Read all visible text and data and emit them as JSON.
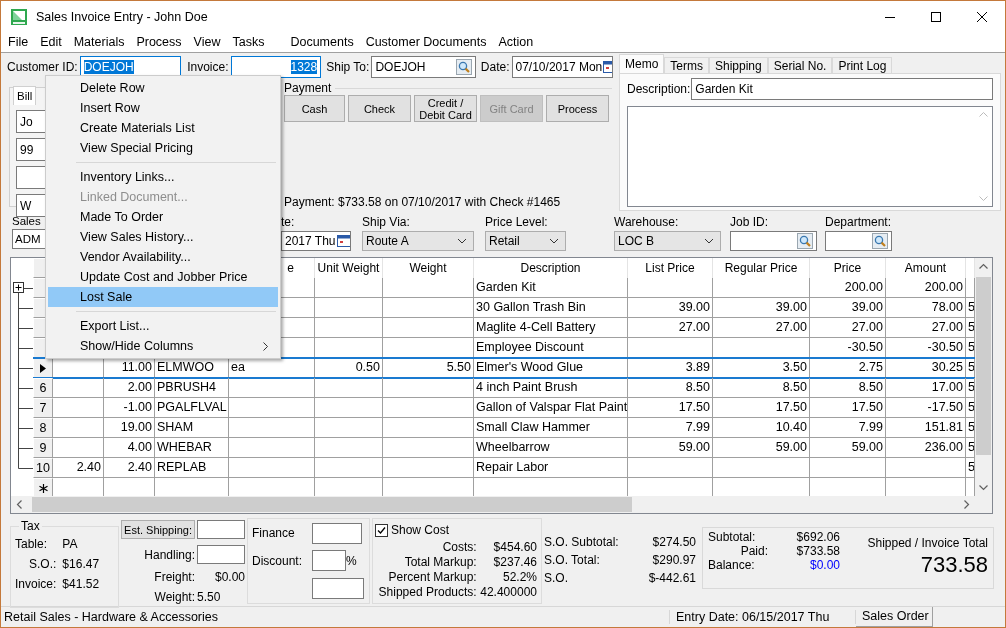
{
  "window": {
    "title": "Sales Invoice Entry - John Doe"
  },
  "menu_bar": [
    "File",
    "Edit",
    "Materials",
    "Process",
    "View",
    "Tasks",
    "Documents",
    "Customer Documents",
    "Action"
  ],
  "header_fields": [
    {
      "label": "Customer ID:",
      "value": "DOEJOH",
      "kind": "text",
      "selected": true
    },
    {
      "label": "Invoice:",
      "value": "1328",
      "kind": "number",
      "selected": true
    },
    {
      "label": "Ship To:",
      "value": "DOEJOH",
      "kind": "lookup",
      "selected": false
    },
    {
      "label": "Date:",
      "value": "07/10/2017 Mon",
      "kind": "date",
      "selected": false
    }
  ],
  "bill_to": {
    "tab": "Bill",
    "lines": [
      {
        "kind": "text",
        "value": "Jo"
      },
      {
        "kind": "text",
        "value": "99"
      },
      {
        "kind": "empty"
      },
      {
        "kind": "text",
        "value": "W"
      }
    ]
  },
  "payment": {
    "title": "Payment",
    "buttons": [
      {
        "label": "Cash",
        "disabled": false
      },
      {
        "label": "Check",
        "disabled": false
      },
      {
        "label": "Credit / Debit Card",
        "disabled": false
      },
      {
        "label": "Gift Card",
        "disabled": true
      },
      {
        "label": "Process",
        "disabled": false
      }
    ],
    "note": "Payment: $733.58 on 07/10/2017 with Check #1465"
  },
  "memo": {
    "tabs": [
      {
        "label": "Memo",
        "selected": true
      },
      {
        "label": "Terms",
        "selected": false
      },
      {
        "label": "Shipping",
        "selected": false
      },
      {
        "label": "Serial No.",
        "selected": false
      },
      {
        "label": "Print Log",
        "selected": false
      }
    ],
    "description_label": "Description:",
    "description": "Garden Kit"
  },
  "order_fields": [
    {
      "label": "Sales",
      "value": "ADM",
      "kind": "text"
    },
    {
      "label": "te:",
      "value": "2017 Thu",
      "kind": "date"
    },
    {
      "label": "Ship Via:",
      "value": "Route A",
      "kind": "select"
    },
    {
      "label": "Price Level:",
      "value": "Retail",
      "kind": "select"
    },
    {
      "label": "Warehouse:",
      "value": "LOC B",
      "kind": "select"
    },
    {
      "label": "Job ID:",
      "kind": "lookup"
    },
    {
      "label": "Department:",
      "kind": "lookup"
    }
  ],
  "table": {
    "columns": {
      "column_4": "e",
      "unit_weight": "Unit Weight",
      "weight": "Weight",
      "description": "Description",
      "list_price": "List Price",
      "regular_price": "Regular Price",
      "price": "Price",
      "amount": "Amount"
    },
    "rows": [
      {
        "kind": "group",
        "selected": false,
        "cells": {
          "description": "Garden Kit",
          "price": "200.00",
          "amount": "200.00"
        }
      },
      {
        "kind": "item",
        "selected": false,
        "cells": {
          "description": "30 Gallon Trash Bin",
          "list_price": "39.00",
          "regular_price": "39.00",
          "price": "39.00",
          "amount": "78.00",
          "column_12": "5"
        }
      },
      {
        "kind": "item",
        "selected": false,
        "cells": {
          "description": "Maglite 4-Cell Battery",
          "list_price": "27.00",
          "regular_price": "27.00",
          "price": "27.00",
          "amount": "27.00",
          "column_12": "5"
        }
      },
      {
        "kind": "item",
        "selected": false,
        "cells": {
          "description": "Employee Discount",
          "price": "-30.50",
          "amount": "-30.50",
          "column_12": "5"
        }
      },
      {
        "kind": "item",
        "selected": true,
        "cells": {
          "column_2": "11.00",
          "column_3": "ELMWOO",
          "column_4": "ea",
          "unit_weight": "0.50",
          "weight": "5.50",
          "description": "Elmer's Wood Glue",
          "list_price": "3.89",
          "regular_price": "3.50",
          "price": "2.75",
          "amount": "30.25",
          "column_12": "5"
        }
      },
      {
        "kind": "item",
        "selected": false,
        "number": "6",
        "cells": {
          "column_2": "2.00",
          "column_3": "PBRUSH4",
          "description": "4 inch Paint Brush",
          "list_price": "8.50",
          "regular_price": "8.50",
          "price": "8.50",
          "amount": "17.00",
          "column_12": "5"
        }
      },
      {
        "kind": "item",
        "selected": false,
        "number": "7",
        "cells": {
          "column_2": "-1.00",
          "column_3": "PGALFLVAL",
          "description": "Gallon of Valspar Flat Paint",
          "list_price": "17.50",
          "regular_price": "17.50",
          "price": "17.50",
          "amount": "-17.50",
          "column_12": "5"
        }
      },
      {
        "kind": "item",
        "selected": false,
        "number": "8",
        "cells": {
          "column_2": "19.00",
          "column_3": "SHAM",
          "description": "Small Claw Hammer",
          "list_price": "7.99",
          "regular_price": "10.40",
          "price": "7.99",
          "amount": "151.81",
          "column_12": "5"
        }
      },
      {
        "kind": "item",
        "selected": false,
        "number": "9",
        "cells": {
          "column_2": "4.00",
          "column_3": "WHEBAR",
          "description": "Wheelbarrow",
          "list_price": "59.00",
          "regular_price": "59.00",
          "price": "59.00",
          "amount": "236.00",
          "column_12": "5"
        }
      },
      {
        "kind": "item",
        "selected": false,
        "number": "10",
        "cells": {
          "column_1": "2.40",
          "column_2": "2.40",
          "column_3": "REPLAB",
          "description": "Repair Labor",
          "column_12": "5"
        }
      },
      {
        "kind": "new",
        "selected": false,
        "cells": {}
      }
    ]
  },
  "tax": {
    "title": "Tax",
    "table_label": "Table:",
    "table": "PA",
    "so_label": "S.O.:",
    "so": "$16.47",
    "invoice_label": "Invoice:",
    "invoice": "$41.52"
  },
  "shipping": {
    "est_button": "Est. Shipping:",
    "handling_label": "Handling:",
    "freight_label": "Freight:",
    "freight": "$0.00",
    "weight_label": "Weight:",
    "weight": "5.50"
  },
  "finance": {
    "finance_label": "Finance",
    "discount_label": "Discount:",
    "percent": "%"
  },
  "cost": {
    "show_cost": {
      "label": "Show Cost",
      "checked": true
    },
    "rows": [
      {
        "label": "Costs:",
        "value": "$454.60"
      },
      {
        "label": "Total Markup:",
        "value": "$237.46"
      },
      {
        "label": "Percent Markup:",
        "value": "52.2%"
      },
      {
        "label": "Shipped Products:",
        "value": "42.400000"
      }
    ]
  },
  "sales_order": {
    "rows": [
      {
        "label": "S.O. Subtotal:",
        "value": "$274.50"
      },
      {
        "label": "S.O. Total:",
        "value": "$290.97"
      },
      {
        "label": "S.O.",
        "value": "$-442.61"
      }
    ]
  },
  "totals": {
    "rows": [
      {
        "label": "Subtotal:",
        "value": "$692.06",
        "color": "#000000"
      },
      {
        "label": "Paid:",
        "value": "$733.58",
        "color": "#000000"
      },
      {
        "label": "Balance:",
        "value": "$0.00",
        "color": "#0000ff"
      }
    ],
    "grand_label": "Shipped / Invoice Total",
    "grand_total": "733.58"
  },
  "context_menu": {
    "items": [
      {
        "kind": "item",
        "label": "Delete Row",
        "disabled": false,
        "selected": false
      },
      {
        "kind": "item",
        "label": "Insert Row",
        "disabled": false,
        "selected": false
      },
      {
        "kind": "item",
        "label": "Create Materials List",
        "disabled": false,
        "selected": false
      },
      {
        "kind": "item",
        "label": "View Special Pricing",
        "disabled": false,
        "selected": false
      },
      {
        "kind": "separator"
      },
      {
        "kind": "item",
        "label": "Inventory Links...",
        "disabled": false,
        "selected": false
      },
      {
        "kind": "item",
        "label": "Linked Document...",
        "disabled": true,
        "selected": false
      },
      {
        "kind": "item",
        "label": "Made To Order",
        "disabled": false,
        "selected": false
      },
      {
        "kind": "item",
        "label": "View Sales History...",
        "disabled": false,
        "selected": false
      },
      {
        "kind": "item",
        "label": "Vendor Availability...",
        "disabled": false,
        "selected": false
      },
      {
        "kind": "item",
        "label": "Update Cost and Jobber Price",
        "disabled": false,
        "selected": false
      },
      {
        "kind": "item",
        "label": "Lost Sale",
        "disabled": false,
        "selected": true
      },
      {
        "kind": "separator"
      },
      {
        "kind": "item",
        "label": "Export List...",
        "disabled": false,
        "selected": false
      },
      {
        "kind": "submenu",
        "label": "Show/Hide Columns",
        "disabled": false,
        "selected": false
      }
    ]
  },
  "status_bar": [
    "Retail Sales - Hardware & Accessories",
    "Entry Date: 06/15/2017 Thu",
    "Sales Order"
  ]
}
